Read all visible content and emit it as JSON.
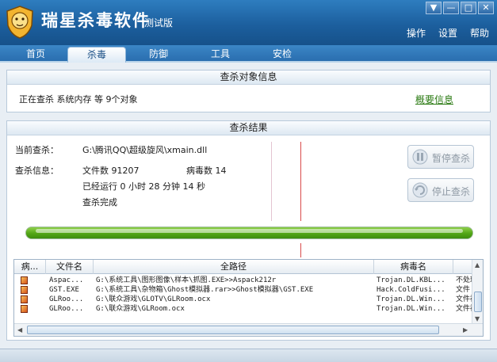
{
  "app": {
    "title": "瑞星杀毒软件",
    "subtitle": "测试版",
    "window_buttons": [
      "▼",
      "—",
      "□",
      "✕"
    ],
    "menu": [
      "操作",
      "设置",
      "帮助"
    ]
  },
  "tabs": [
    {
      "label": "首页",
      "active": false
    },
    {
      "label": "杀毒",
      "active": true
    },
    {
      "label": "防御",
      "active": false
    },
    {
      "label": "工具",
      "active": false
    },
    {
      "label": "安检",
      "active": false
    }
  ],
  "target_panel": {
    "header": "查杀对象信息",
    "status_line": "正在查杀  系统内存  等  9个对象",
    "summary_link": "概要信息"
  },
  "result_panel": {
    "header": "查杀结果",
    "current_label": "当前查杀：",
    "current_value": "G:\\腾讯QQ\\超级旋风\\xmain.dll",
    "info_label": "查杀信息：",
    "file_count": "文件数  91207",
    "virus_count": "病毒数  14",
    "elapsed": "已经运行  0  小时  28  分钟  14  秒",
    "done": "查杀完成",
    "pause_button": "暂停查杀",
    "stop_button": "停止查杀",
    "progress_percent": 100
  },
  "grid": {
    "columns": [
      "病...",
      "文件名",
      "全路径",
      "病毒名",
      ""
    ],
    "rows": [
      {
        "file": "Aspac...",
        "path": "G:\\系统工具\\图形图像\\样本\\抓图.EXE>>Aspack212r",
        "virus": "Trojan.DL.KBL...",
        "action": "不处理"
      },
      {
        "file": "GST.EXE",
        "path": "G:\\系统工具\\杂物箱\\Ghost模拟器.rar>>Ghost模拟器\\GST.EXE",
        "virus": "Hack.ColdFusi...",
        "action": "文件"
      },
      {
        "file": "GLRoo...",
        "path": "G:\\联众游戏\\GLOTV\\GLRoom.ocx",
        "virus": "Trojan.DL.Win...",
        "action": "文件被"
      },
      {
        "file": "GLRoo...",
        "path": "G:\\联众游戏\\GLRoom.ocx",
        "virus": "Trojan.DL.Win...",
        "action": "文件被"
      }
    ]
  },
  "colors": {
    "titlebar": "#1c5f9e",
    "progress": "#52a616",
    "link": "#2a7a12",
    "marker_red": "#d94a4a"
  }
}
